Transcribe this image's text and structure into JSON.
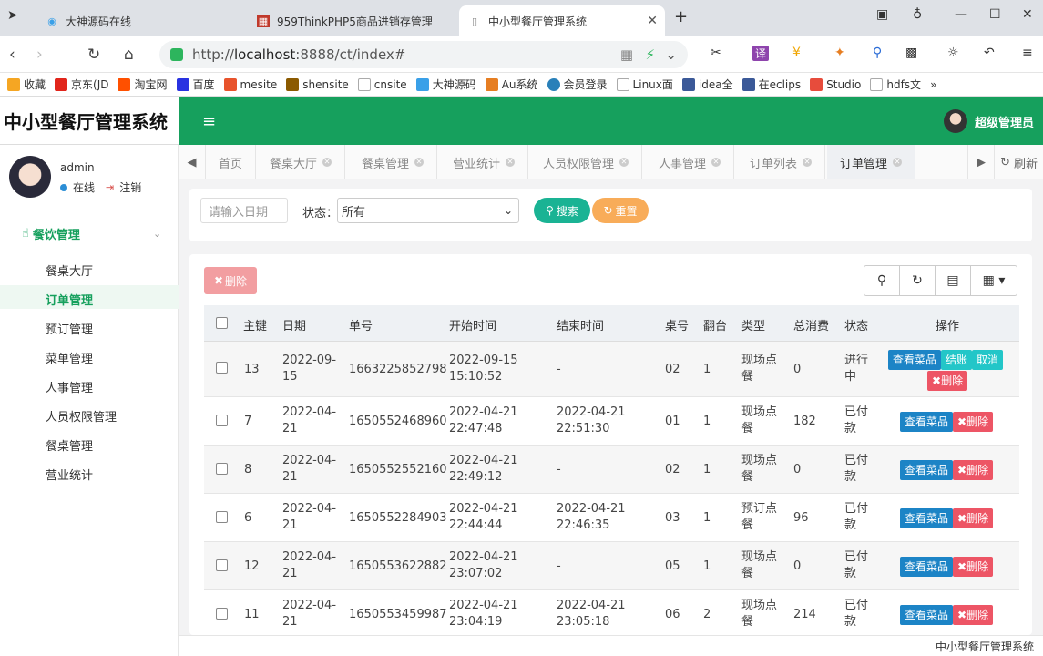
{
  "browser": {
    "tabs": [
      {
        "title": "大神源码在线",
        "active": false
      },
      {
        "title": "959ThinkPHP5商品进销存管理",
        "active": false
      },
      {
        "title": "中小型餐厅管理系统",
        "active": true
      }
    ],
    "new_tab": "+",
    "url_prefix": "http://",
    "url_host": "localhost",
    "url_rest": ":8888/ct/index#",
    "bookmarks": [
      {
        "label": "收藏",
        "color": "#f5a623"
      },
      {
        "label": "京东(JD",
        "color": "#e1251b"
      },
      {
        "label": "淘宝网",
        "color": "#ff5000"
      },
      {
        "label": "百度",
        "color": "#2932e1"
      },
      {
        "label": "mesite",
        "color": "#e8532c"
      },
      {
        "label": "shensite",
        "color": "#8b5a00"
      },
      {
        "label": "cnsite",
        "color": "#cccccc"
      },
      {
        "label": "大神源码",
        "color": "#3aa0e8"
      },
      {
        "label": "Au系统",
        "color": "#e67e22"
      },
      {
        "label": "会员登录",
        "color": "#2980b9"
      },
      {
        "label": "Linux面",
        "color": "#cccccc"
      },
      {
        "label": "idea全",
        "color": "#3b5998"
      },
      {
        "label": "在eclips",
        "color": "#3b5998"
      },
      {
        "label": "Studio",
        "color": "#e74c3c"
      },
      {
        "label": "hdfs文",
        "color": "#cccccc"
      }
    ],
    "bookmarks_more": "»"
  },
  "app": {
    "title": "中小型餐厅管理系统",
    "menu_toggle": "≡",
    "current_user": "超级管理员",
    "footer": "中小型餐厅管理系统"
  },
  "sidebar": {
    "username": "admin",
    "status": "在线",
    "logout": "注销",
    "group": "餐饮管理",
    "items": [
      {
        "label": "餐桌大厅",
        "active": false
      },
      {
        "label": "订单管理",
        "active": true
      },
      {
        "label": "预订管理",
        "active": false
      },
      {
        "label": "菜单管理",
        "active": false
      },
      {
        "label": "人事管理",
        "active": false
      },
      {
        "label": "人员权限管理",
        "active": false
      },
      {
        "label": "餐桌管理",
        "active": false
      },
      {
        "label": "营业统计",
        "active": false
      }
    ]
  },
  "page_tabs": {
    "items": [
      {
        "label": "首页",
        "closable": false,
        "active": false
      },
      {
        "label": "餐桌大厅",
        "closable": true,
        "active": false
      },
      {
        "label": "餐桌管理",
        "closable": true,
        "active": false
      },
      {
        "label": "营业统计",
        "closable": true,
        "active": false
      },
      {
        "label": "人员权限管理",
        "closable": true,
        "active": false
      },
      {
        "label": "人事管理",
        "closable": true,
        "active": false
      },
      {
        "label": "订单列表",
        "closable": true,
        "active": false
      },
      {
        "label": "订单管理",
        "closable": true,
        "active": true
      }
    ],
    "refresh": "刷新"
  },
  "filter": {
    "date_placeholder": "请输入日期",
    "status_label": "状态：",
    "status_value": "所有",
    "search_btn": "搜索",
    "reset_btn": "重置"
  },
  "toolbar": {
    "delete_btn": "删除"
  },
  "table": {
    "headers": {
      "id": "主键",
      "date": "日期",
      "no": "单号",
      "start": "开始时间",
      "end": "结束时间",
      "table_no": "桌号",
      "turn": "翻台",
      "type": "类型",
      "total": "总消费",
      "status": "状态",
      "ops": "操作"
    },
    "buttons": {
      "view": "查看菜品",
      "pay": "结账",
      "cancel": "取消",
      "delete": "删除"
    },
    "rows": [
      {
        "id": "13",
        "date": "2022-09-15",
        "no": "1663225852798",
        "start": "2022-09-15 15:10:52",
        "end": "-",
        "table_no": "02",
        "turn": "1",
        "type": "现场点餐",
        "total": "0",
        "status": "进行中",
        "in_progress": true
      },
      {
        "id": "7",
        "date": "2022-04-21",
        "no": "1650552468960",
        "start": "2022-04-21 22:47:48",
        "end": "2022-04-21 22:51:30",
        "table_no": "01",
        "turn": "1",
        "type": "现场点餐",
        "total": "182",
        "status": "已付款",
        "in_progress": false
      },
      {
        "id": "8",
        "date": "2022-04-21",
        "no": "1650552552160",
        "start": "2022-04-21 22:49:12",
        "end": "-",
        "table_no": "02",
        "turn": "1",
        "type": "现场点餐",
        "total": "0",
        "status": "已付款",
        "in_progress": false
      },
      {
        "id": "6",
        "date": "2022-04-21",
        "no": "1650552284903",
        "start": "2022-04-21 22:44:44",
        "end": "2022-04-21 22:46:35",
        "table_no": "03",
        "turn": "1",
        "type": "预订点餐",
        "total": "96",
        "status": "已付款",
        "in_progress": false
      },
      {
        "id": "12",
        "date": "2022-04-21",
        "no": "1650553622882",
        "start": "2022-04-21 23:07:02",
        "end": "-",
        "table_no": "05",
        "turn": "1",
        "type": "现场点餐",
        "total": "0",
        "status": "已付款",
        "in_progress": false
      },
      {
        "id": "11",
        "date": "2022-04-21",
        "no": "1650553459987",
        "start": "2022-04-21 23:04:19",
        "end": "2022-04-21 23:05:18",
        "table_no": "06",
        "turn": "2",
        "type": "现场点餐",
        "total": "214",
        "status": "已付款",
        "in_progress": false
      }
    ]
  },
  "colors": {
    "brand": "#16a05d",
    "view": "#1c84c6",
    "pay": "#23c6c8",
    "delete": "#ed5565",
    "search": "#1ab394",
    "reset": "#f8ac59"
  }
}
